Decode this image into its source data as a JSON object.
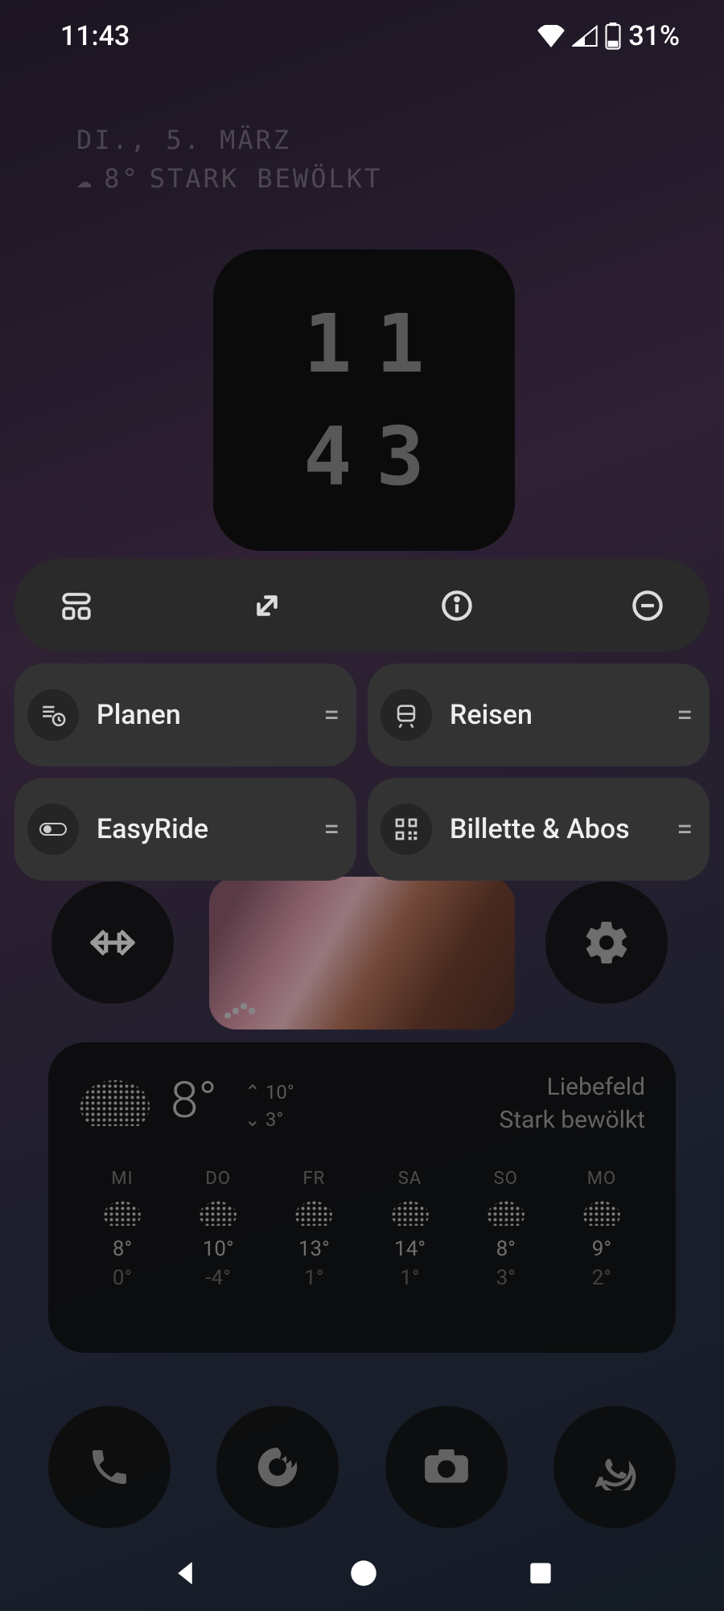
{
  "status": {
    "time": "11:43",
    "battery_pct": "31%"
  },
  "header": {
    "date_line": "DI., 5. MÄRZ",
    "temp": "8°",
    "condition": "STARK BEWÖLKT"
  },
  "clock": {
    "hours": "11",
    "minutes": "43"
  },
  "shortcuts": [
    {
      "label": "Planen"
    },
    {
      "label": "Reisen"
    },
    {
      "label": "EasyRide"
    },
    {
      "label": "Billette & Abos"
    }
  ],
  "weather": {
    "location": "Liebefeld",
    "condition": "Stark bewölkt",
    "current_temp": "8°",
    "high": "10°",
    "low": "3°",
    "days": [
      {
        "name": "MI",
        "hi": "8°",
        "lo": "0°"
      },
      {
        "name": "DO",
        "hi": "10°",
        "lo": "-4°"
      },
      {
        "name": "FR",
        "hi": "13°",
        "lo": "1°"
      },
      {
        "name": "SA",
        "hi": "14°",
        "lo": "1°"
      },
      {
        "name": "SO",
        "hi": "8°",
        "lo": "3°"
      },
      {
        "name": "MO",
        "hi": "9°",
        "lo": "2°"
      }
    ]
  }
}
